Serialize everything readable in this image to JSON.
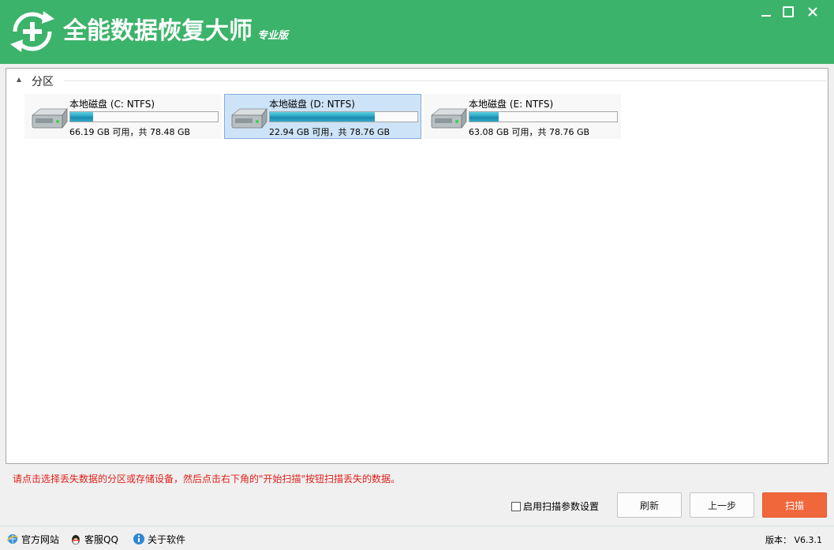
{
  "app": {
    "title": "全能数据恢复大师",
    "edition": "专业版"
  },
  "section": {
    "title": "分区"
  },
  "drives": [
    {
      "name": "本地磁盘 (C: NTFS)",
      "info": "66.19 GB 可用，共 78.48 GB",
      "used_fraction": 0.157,
      "selected": false
    },
    {
      "name": "本地磁盘 (D: NTFS)",
      "info": "22.94 GB 可用，共 78.76 GB",
      "used_fraction": 0.709,
      "selected": true
    },
    {
      "name": "本地磁盘 (E: NTFS)",
      "info": "63.08 GB 可用，共 78.76 GB",
      "used_fraction": 0.2,
      "selected": false
    }
  ],
  "hint": "请点击选择丢失数据的分区或存储设备，然后点击右下角的\"开始扫描\"按钮扫描丢失的数据。",
  "options": {
    "scan_params_label": "启用扫描参数设置",
    "scan_params_checked": false
  },
  "buttons": {
    "refresh": "刷新",
    "back": "上一步",
    "scan": "扫描"
  },
  "status": {
    "official_site": "官方网站",
    "support_qq": "客服QQ",
    "about": "关于软件",
    "version": "版本： V6.3.1"
  },
  "colors": {
    "header": "#3cb36a",
    "scan_button": "#f0673b",
    "hint": "#e0201a",
    "selected_bg": "#cde3f7"
  }
}
